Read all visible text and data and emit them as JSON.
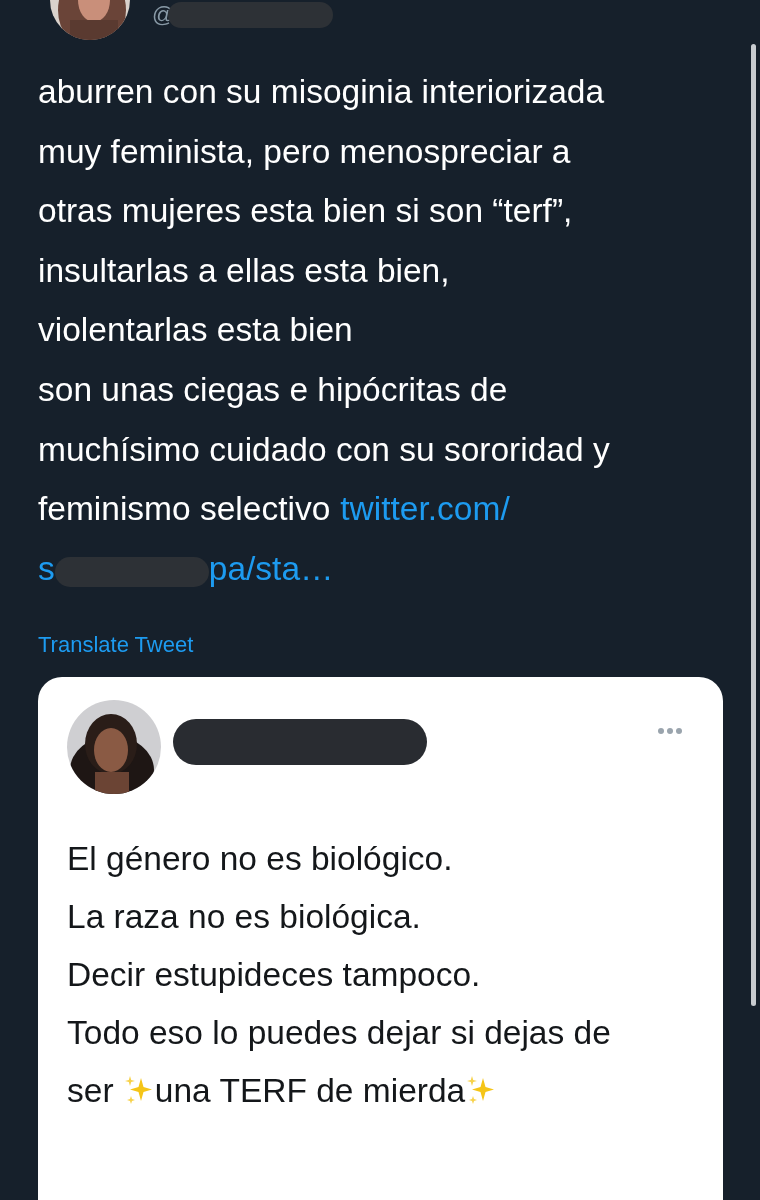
{
  "author": {
    "handle_prefix": "@"
  },
  "tweet": {
    "lines": [
      "aburren con su misoginia interiorizada",
      "muy feminista, pero menospreciar a",
      "otras mujeres esta bien si son “terf”,",
      "insultarlas a ellas esta bien,",
      "violentarlas esta bien",
      "son unas ciegas e hipócritas de",
      "muchísimo cuidado con su sororidad y"
    ],
    "last_line": {
      "text": "feminismo selectivo",
      "link": "twitter.com/"
    },
    "link_continuation": {
      "start": "s",
      "end": "pa/sta…"
    }
  },
  "translate_link": "Translate Tweet",
  "quoted_tweet": {
    "lines": [
      {
        "segments": [
          {
            "kind": "text",
            "text": "El género no es biológico."
          }
        ]
      },
      {
        "segments": [
          {
            "kind": "text",
            "text": "La raza no es biológica."
          }
        ]
      },
      {
        "segments": [
          {
            "kind": "text",
            "text": "Decir estupideces tampoco."
          }
        ]
      },
      {
        "segments": [
          {
            "kind": "text",
            "text": "Todo eso lo puedes dejar si dejas de"
          }
        ]
      },
      {
        "segments": [
          {
            "kind": "text",
            "text": "ser "
          },
          {
            "kind": "sparkles"
          },
          {
            "kind": "text",
            "text": "una TERF de mierda"
          },
          {
            "kind": "sparkles"
          }
        ]
      }
    ]
  }
}
